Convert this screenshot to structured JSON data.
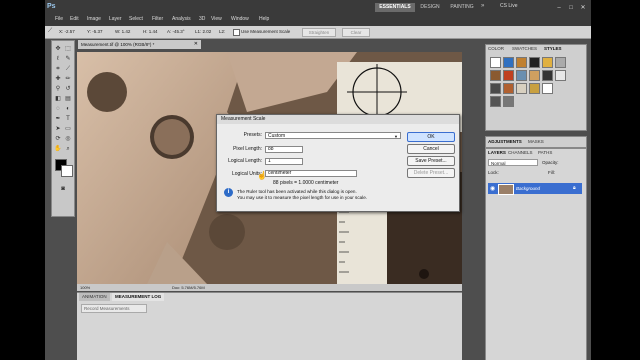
{
  "menubar": {
    "logo": "Ps",
    "items": [
      "File",
      "Edit",
      "Image",
      "Layer",
      "Select",
      "Filter",
      "Analysis",
      "3D",
      "View",
      "Window",
      "Help"
    ],
    "workspaces": {
      "essentials": "ESSENTIALS",
      "design": "DESIGN",
      "painting": "PAINTING"
    },
    "cslive": "CS Live"
  },
  "options": {
    "x": "X: -2.57",
    "y": "Y: -5.37",
    "w": "W: 1.42",
    "h": "H: 1.44",
    "a": "A: -45.3°",
    "l1": "L1: 2.02",
    "l2": "L2:",
    "use_scale_label": "Use Measurement Scale",
    "straighten": "Straighten",
    "clear": "Clear"
  },
  "document": {
    "tab_title": "Measurement.tif @ 100% (RGB/8*) *",
    "status_zoom": "100%",
    "status_doc": "Doc: 5.76M/5.76M"
  },
  "bottom_panel": {
    "tabs": [
      "ANIMATION",
      "MEASUREMENT LOG"
    ],
    "record_button": "Record Measurements"
  },
  "right_panels": {
    "swatch_tabs": [
      "COLOR",
      "SWATCHES",
      "STYLES"
    ],
    "adjust_tabs": [
      "ADJUSTMENTS",
      "MASKS"
    ],
    "layer_tabs": [
      "LAYERS",
      "CHANNELS",
      "PATHS"
    ],
    "blend_mode": "Normal",
    "opacity_label": "Opacity:",
    "lock_label": "Lock:",
    "fill_label": "Fill:",
    "layer_name": "Background"
  },
  "dialog": {
    "title": "Measurement Scale",
    "presets_label": "Presets:",
    "presets_value": "Custom",
    "pixel_length_label": "Pixel Length:",
    "pixel_length_value": "88",
    "logical_length_label": "Logical Length:",
    "logical_length_value": "1",
    "logical_units_label": "Logical Units:",
    "logical_units_value": "centimeter",
    "ratio_text": "88 pixels = 1.0000 centimeter",
    "info_line1": "The Ruler tool has been activated while this dialog is open.",
    "info_line2": "You may use it to measure the pixel length for use in your scale.",
    "ok": "OK",
    "cancel": "Cancel",
    "save_preset": "Save Preset...",
    "delete_preset": "Delete Preset..."
  },
  "colors": {
    "accent": "#3a6ed0",
    "canvas_bg": "#7a6450",
    "metal": "#c8ad95"
  }
}
